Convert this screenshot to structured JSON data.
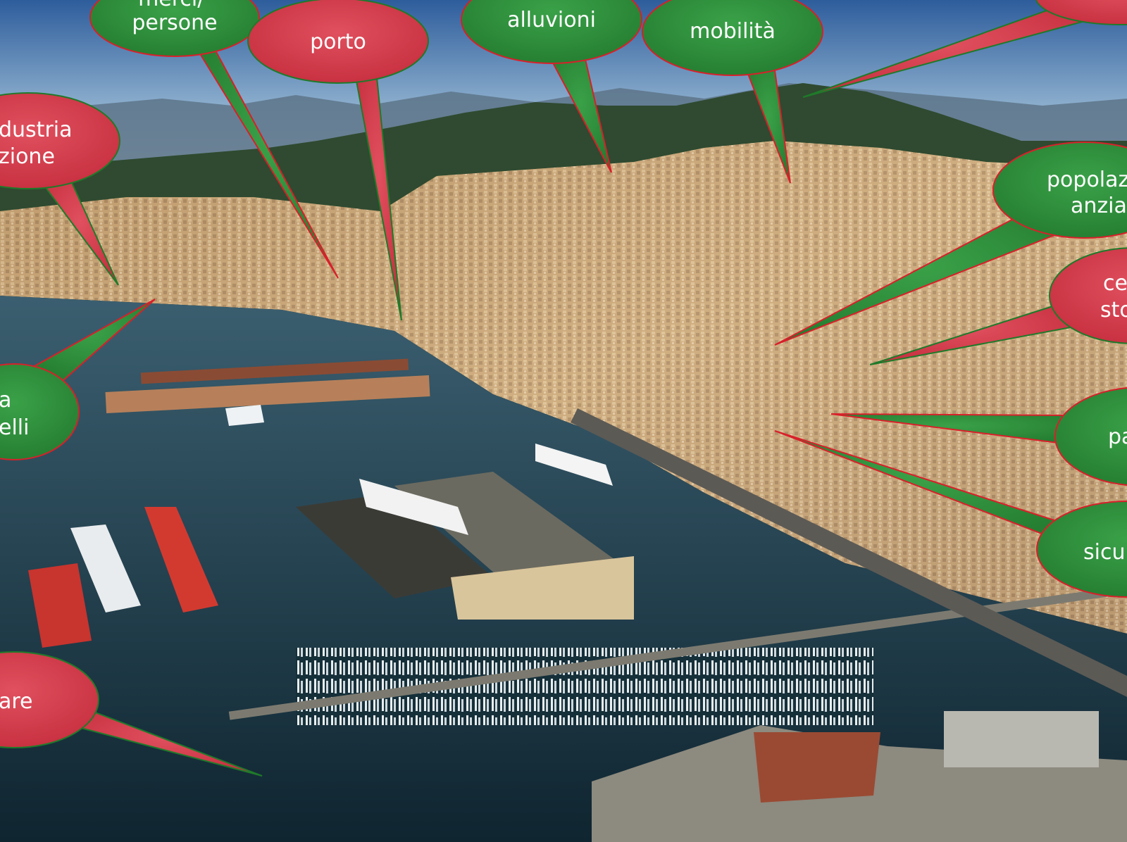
{
  "colors": {
    "bubble_green": "#2e8b3a",
    "bubble_red": "#d63a4a",
    "bubble_green_border": "#d8202a",
    "bubble_red_border": "#1f7a2a",
    "sky_top": "#2a5a9a",
    "sky_horizon": "#c9d8e6",
    "mountains": "#3c5a3a",
    "sea": "#1d3c4a",
    "city": "#c9a97a"
  },
  "bubbles": [
    {
      "id": "merci-persone",
      "color": "green",
      "lines": [
        "merci/",
        "persone"
      ]
    },
    {
      "id": "porto",
      "color": "red",
      "lines": [
        "porto"
      ]
    },
    {
      "id": "alluvioni",
      "color": "green",
      "lines": [
        "alluvioni"
      ]
    },
    {
      "id": "mobilita",
      "color": "green",
      "lines": [
        "mobilità"
      ]
    },
    {
      "id": "top-right",
      "color": "red",
      "lines": []
    },
    {
      "id": "industria",
      "color": "red",
      "lines": [
        "dustria",
        "zione"
      ]
    },
    {
      "id": "popolazione",
      "color": "green",
      "lines": [
        "popolaz",
        "anzia"
      ]
    },
    {
      "id": "centro-storico",
      "color": "red",
      "lines": [
        "ce",
        "sto"
      ]
    },
    {
      "id": "caselli",
      "color": "green",
      "lines": [
        "a",
        "elli"
      ]
    },
    {
      "id": "pa",
      "color": "green",
      "lines": [
        "pa"
      ]
    },
    {
      "id": "sicurezza",
      "color": "green",
      "lines": [
        "sicu"
      ]
    },
    {
      "id": "mare",
      "color": "red",
      "lines": [
        "are"
      ]
    }
  ]
}
